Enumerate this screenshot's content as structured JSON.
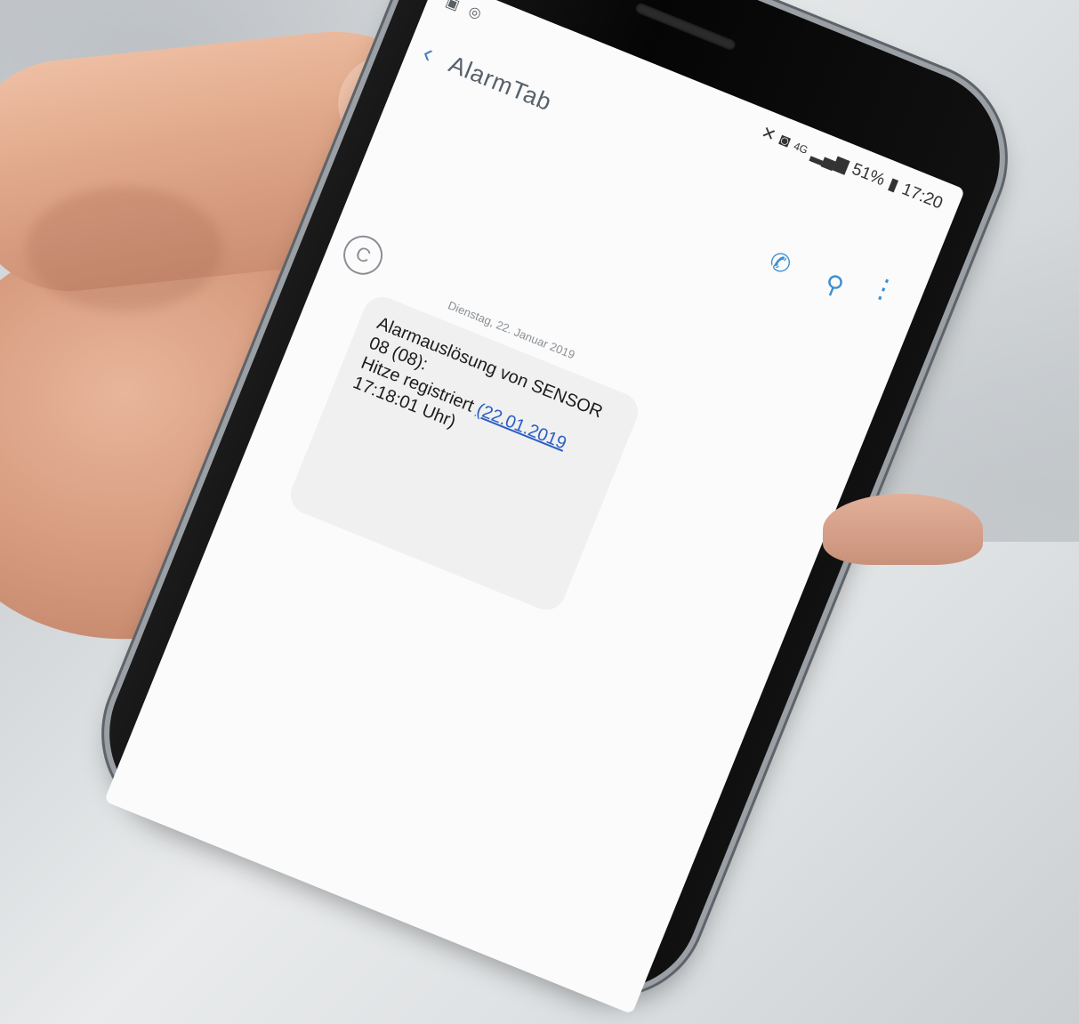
{
  "status_bar": {
    "left_icons": [
      "gallery-icon",
      "shield-check-icon"
    ],
    "battery": "51%",
    "time": "17:20",
    "network": "4G"
  },
  "header": {
    "contact_name": "AlarmTab",
    "back_icon": "chevron-left-icon",
    "call_icon": "phone-icon",
    "search_icon": "search-icon",
    "more_icon": "more-vert-icon"
  },
  "conversation": {
    "date": "Dienstag, 22. Januar 2019",
    "avatar_letter": "C",
    "message": {
      "text": "Alarmauslösung von SENSOR\n08 (08):\nHitze registriert ",
      "text_end": "17:18:01 Uhr)",
      "link_text": "(22.01.2019"
    }
  },
  "colors": {
    "accent": "#3f8fd0",
    "link": "#2c5fc4",
    "bubble": "#f0f0f0"
  }
}
